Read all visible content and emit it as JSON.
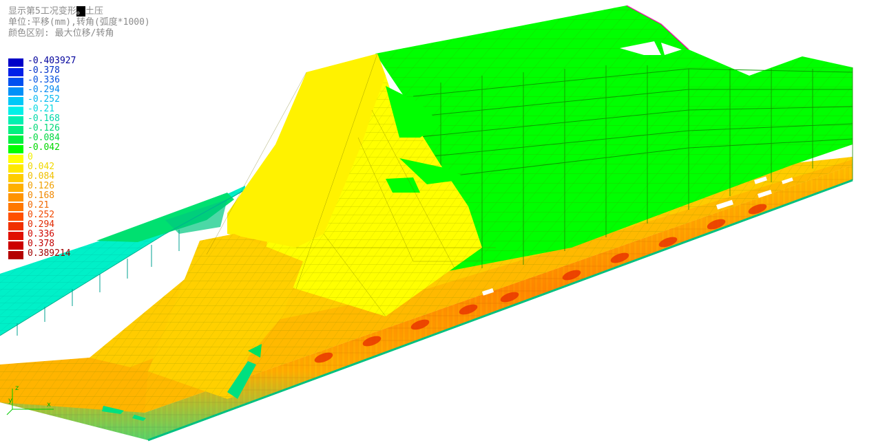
{
  "header": {
    "line1_prefix": "显示第5工况变形",
    "line1_highlight": "。",
    "line1_suffix": "土压",
    "line2": "单位:平移(mm),转角(弧度*1000)",
    "line3": "颜色区别: 最大位移/转角"
  },
  "legend": [
    {
      "label": "-0.403927",
      "color": "#0000c8",
      "text_color": "#00009c"
    },
    {
      "label": "-0.378",
      "color": "#0020e8",
      "text_color": "#0030c8"
    },
    {
      "label": "-0.336",
      "color": "#0050f0",
      "text_color": "#0050e0"
    },
    {
      "label": "-0.294",
      "color": "#0090f8",
      "text_color": "#0088f0"
    },
    {
      "label": "-0.252",
      "color": "#00c8f8",
      "text_color": "#00b8f0"
    },
    {
      "label": "-0.21",
      "color": "#00f0e8",
      "text_color": "#00d8e0"
    },
    {
      "label": "-0.168",
      "color": "#00f0b0",
      "text_color": "#00d8a8"
    },
    {
      "label": "-0.126",
      "color": "#00f080",
      "text_color": "#00d878"
    },
    {
      "label": "-0.084",
      "color": "#00f040",
      "text_color": "#00d840"
    },
    {
      "label": "-0.042",
      "color": "#00ff00",
      "text_color": "#00d800"
    },
    {
      "label": "0",
      "color": "#ffff00",
      "text_color": "#f0f000"
    },
    {
      "label": "0.042",
      "color": "#ffe800",
      "text_color": "#f0d800"
    },
    {
      "label": "0.084",
      "color": "#ffcc00",
      "text_color": "#f0c000"
    },
    {
      "label": "0.126",
      "color": "#ffb000",
      "text_color": "#f0a000"
    },
    {
      "label": "0.168",
      "color": "#ff9400",
      "text_color": "#f08800"
    },
    {
      "label": "0.21",
      "color": "#ff7800",
      "text_color": "#f06800"
    },
    {
      "label": "0.252",
      "color": "#ff5000",
      "text_color": "#f04800"
    },
    {
      "label": "0.294",
      "color": "#f03000",
      "text_color": "#e02800"
    },
    {
      "label": "0.336",
      "color": "#e01000",
      "text_color": "#d00800"
    },
    {
      "label": "0.378",
      "color": "#cc0000",
      "text_color": "#c00000"
    },
    {
      "label": "0.389214",
      "color": "#b40000",
      "text_color": "#a00000"
    }
  ],
  "axis": {
    "x": "x",
    "y": "y",
    "z": "z"
  },
  "colors": {
    "frame_green": "#00ff00",
    "mesh_line": "#6b7f00",
    "slab_yellow": "#ffef00",
    "slab_orange": "#ffcc00",
    "cyan_wing": "#00f0c8"
  }
}
